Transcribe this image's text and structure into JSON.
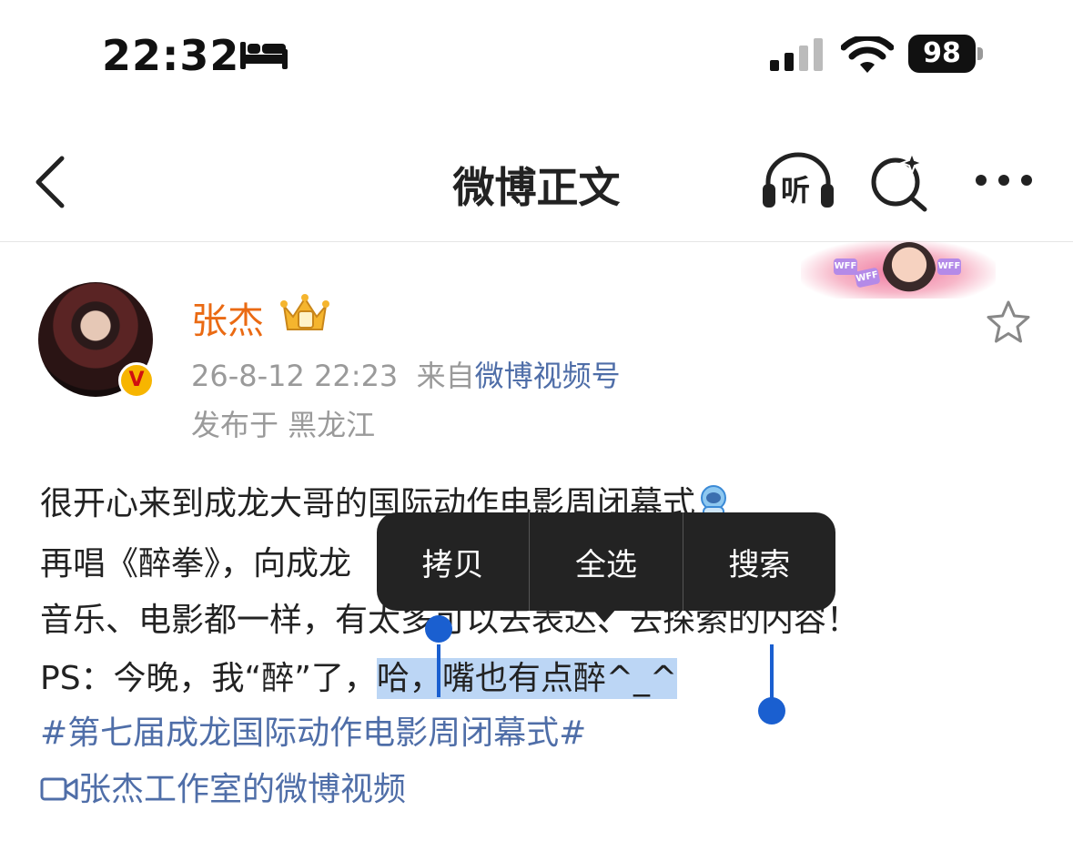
{
  "status_bar": {
    "time": "22:32",
    "battery": "98"
  },
  "header": {
    "title": "微博正文",
    "listen_label": "听"
  },
  "post": {
    "username": "张杰",
    "date": "26-8-12 22:23",
    "from_prefix": "来自",
    "source": "微博视频号",
    "location": "发布于 黑龙江",
    "lines": [
      "很开心来到成龙大哥的国际动作电影周闭幕式",
      "再唱《醉拳》，向成龙",
      "音乐、电影都一样，有太多可以去表达、去探索的内容！"
    ],
    "line4_prefix": "PS：今晚，我“醉”了，",
    "line4_selected": "哈，嘴也有点醉^_^",
    "hashtag": "#第七届成龙国际动作电影周闭幕式#",
    "video_link": "张杰工作室的微博视频",
    "banner_tags": [
      "WFF",
      "WFF",
      "WFF"
    ]
  },
  "context_menu": {
    "copy": "拷贝",
    "select_all": "全选",
    "search": "搜索"
  },
  "colors": {
    "accent_blue": "#4f6ea8",
    "username_orange": "#ea6a13",
    "selection": "#bcd6f5",
    "handle": "#1a5fd0"
  }
}
